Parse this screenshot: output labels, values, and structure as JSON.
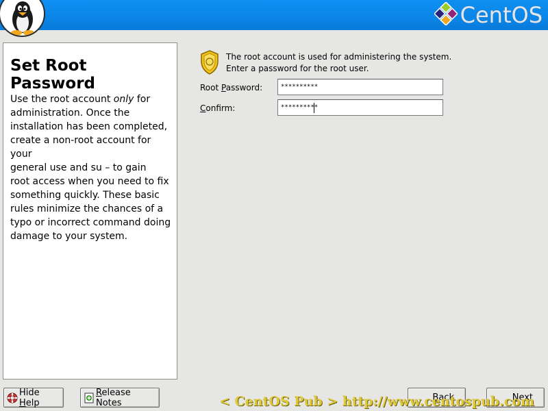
{
  "header": {
    "brand": "CentOS",
    "colors": {
      "bar": "#0b86e8",
      "brand_text": "#dfe6ee"
    },
    "logo_icon": "tux-penguin-icon",
    "brand_icon": "centos-logo-icon"
  },
  "help": {
    "title": "Set Root Password",
    "text_before": "Use the root account ",
    "text_emphasis": "only",
    "text_after": " for\nadministration. Once the\ninstallation has been completed,\ncreate a non-root account for your\ngeneral use and su  – to gain\nroot access when you need to fix\nsomething quickly. These basic\nrules minimize the chances of a\ntypo or incorrect command doing\ndamage to your system."
  },
  "main": {
    "info_icon": "security-badge-icon",
    "info_text": "The root account is used for administering the system.\nEnter a password for the root user.",
    "root_password": {
      "label_pre": "Root ",
      "label_key": "P",
      "label_post": "assword:",
      "value": "**********"
    },
    "confirm": {
      "label_key": "C",
      "label_post": "onfirm:",
      "value": "**********"
    }
  },
  "buttons": {
    "hide_help": {
      "pre": "Hide ",
      "key": "H",
      "post": "elp",
      "icon": "lifebuoy-icon"
    },
    "release_notes": {
      "key": "R",
      "post": "elease Notes",
      "icon": "notes-icon"
    },
    "back": {
      "key": "B",
      "post": "ack",
      "icon": "back-arrow-icon"
    },
    "next": {
      "key": "N",
      "post": "ext",
      "icon": "next-arrow-icon"
    }
  },
  "watermark": "< CentOS Pub > http://www.centospub.com"
}
